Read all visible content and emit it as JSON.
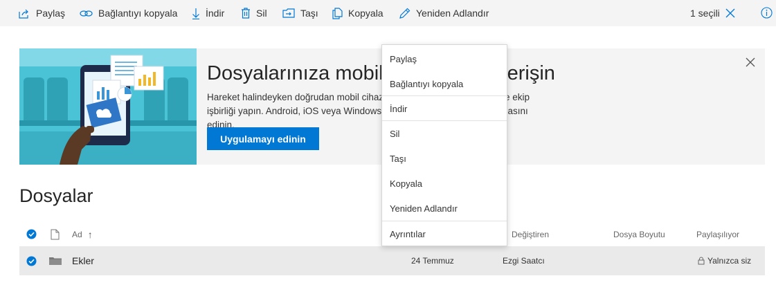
{
  "command_bar": {
    "share": {
      "label": "Paylaş",
      "icon": "share-icon"
    },
    "copy_link": {
      "label": "Bağlantıyı kopyala",
      "icon": "link-icon"
    },
    "download": {
      "label": "İndir",
      "icon": "download-icon"
    },
    "delete": {
      "label": "Sil",
      "icon": "trash-icon"
    },
    "move": {
      "label": "Taşı",
      "icon": "move-icon"
    },
    "copy": {
      "label": "Kopyala",
      "icon": "copy-icon"
    },
    "rename": {
      "label": "Yeniden Adlandır",
      "icon": "pencil-icon"
    },
    "selection_count": "1 seçili"
  },
  "banner": {
    "title": "Dosyalarınıza mobil cihazınızdan erişin",
    "description": "Hareket halindeyken doğrudan mobil cihazınızdan dosyalarınıza erişin ve ekip işbirliği yapın. Android, iOS veya Windows Phone için OneDrive uygulamasını edinin.",
    "button_label": "Uygulamayı edinin"
  },
  "files": {
    "title": "Dosyalar",
    "columns": {
      "name": "Ad",
      "sort_indicator": "↑",
      "modified_by": "Değiştiren",
      "file_size": "Dosya Boyutu",
      "sharing": "Paylaşılıyor"
    },
    "rows": [
      {
        "name": "Ekler",
        "modified": "24 Temmuz",
        "modified_by": "Ezgi Saatcı",
        "sharing": "Yalnızca siz",
        "selected": true
      }
    ]
  },
  "context_menu": {
    "items": [
      {
        "label": "Paylaş"
      },
      {
        "label": "Bağlantıyı kopyala"
      },
      {
        "label": "İndir"
      },
      {
        "label": "Sil"
      },
      {
        "label": "Taşı"
      },
      {
        "label": "Kopyala"
      },
      {
        "label": "Yeniden Adlandır"
      },
      {
        "label": "Ayrıntılar"
      }
    ]
  },
  "colors": {
    "accent": "#0078d4",
    "command_bar_bg": "#f4f4f4",
    "selected_row_bg": "#eaeaea",
    "banner_art_bg": "#4ac3d6"
  }
}
